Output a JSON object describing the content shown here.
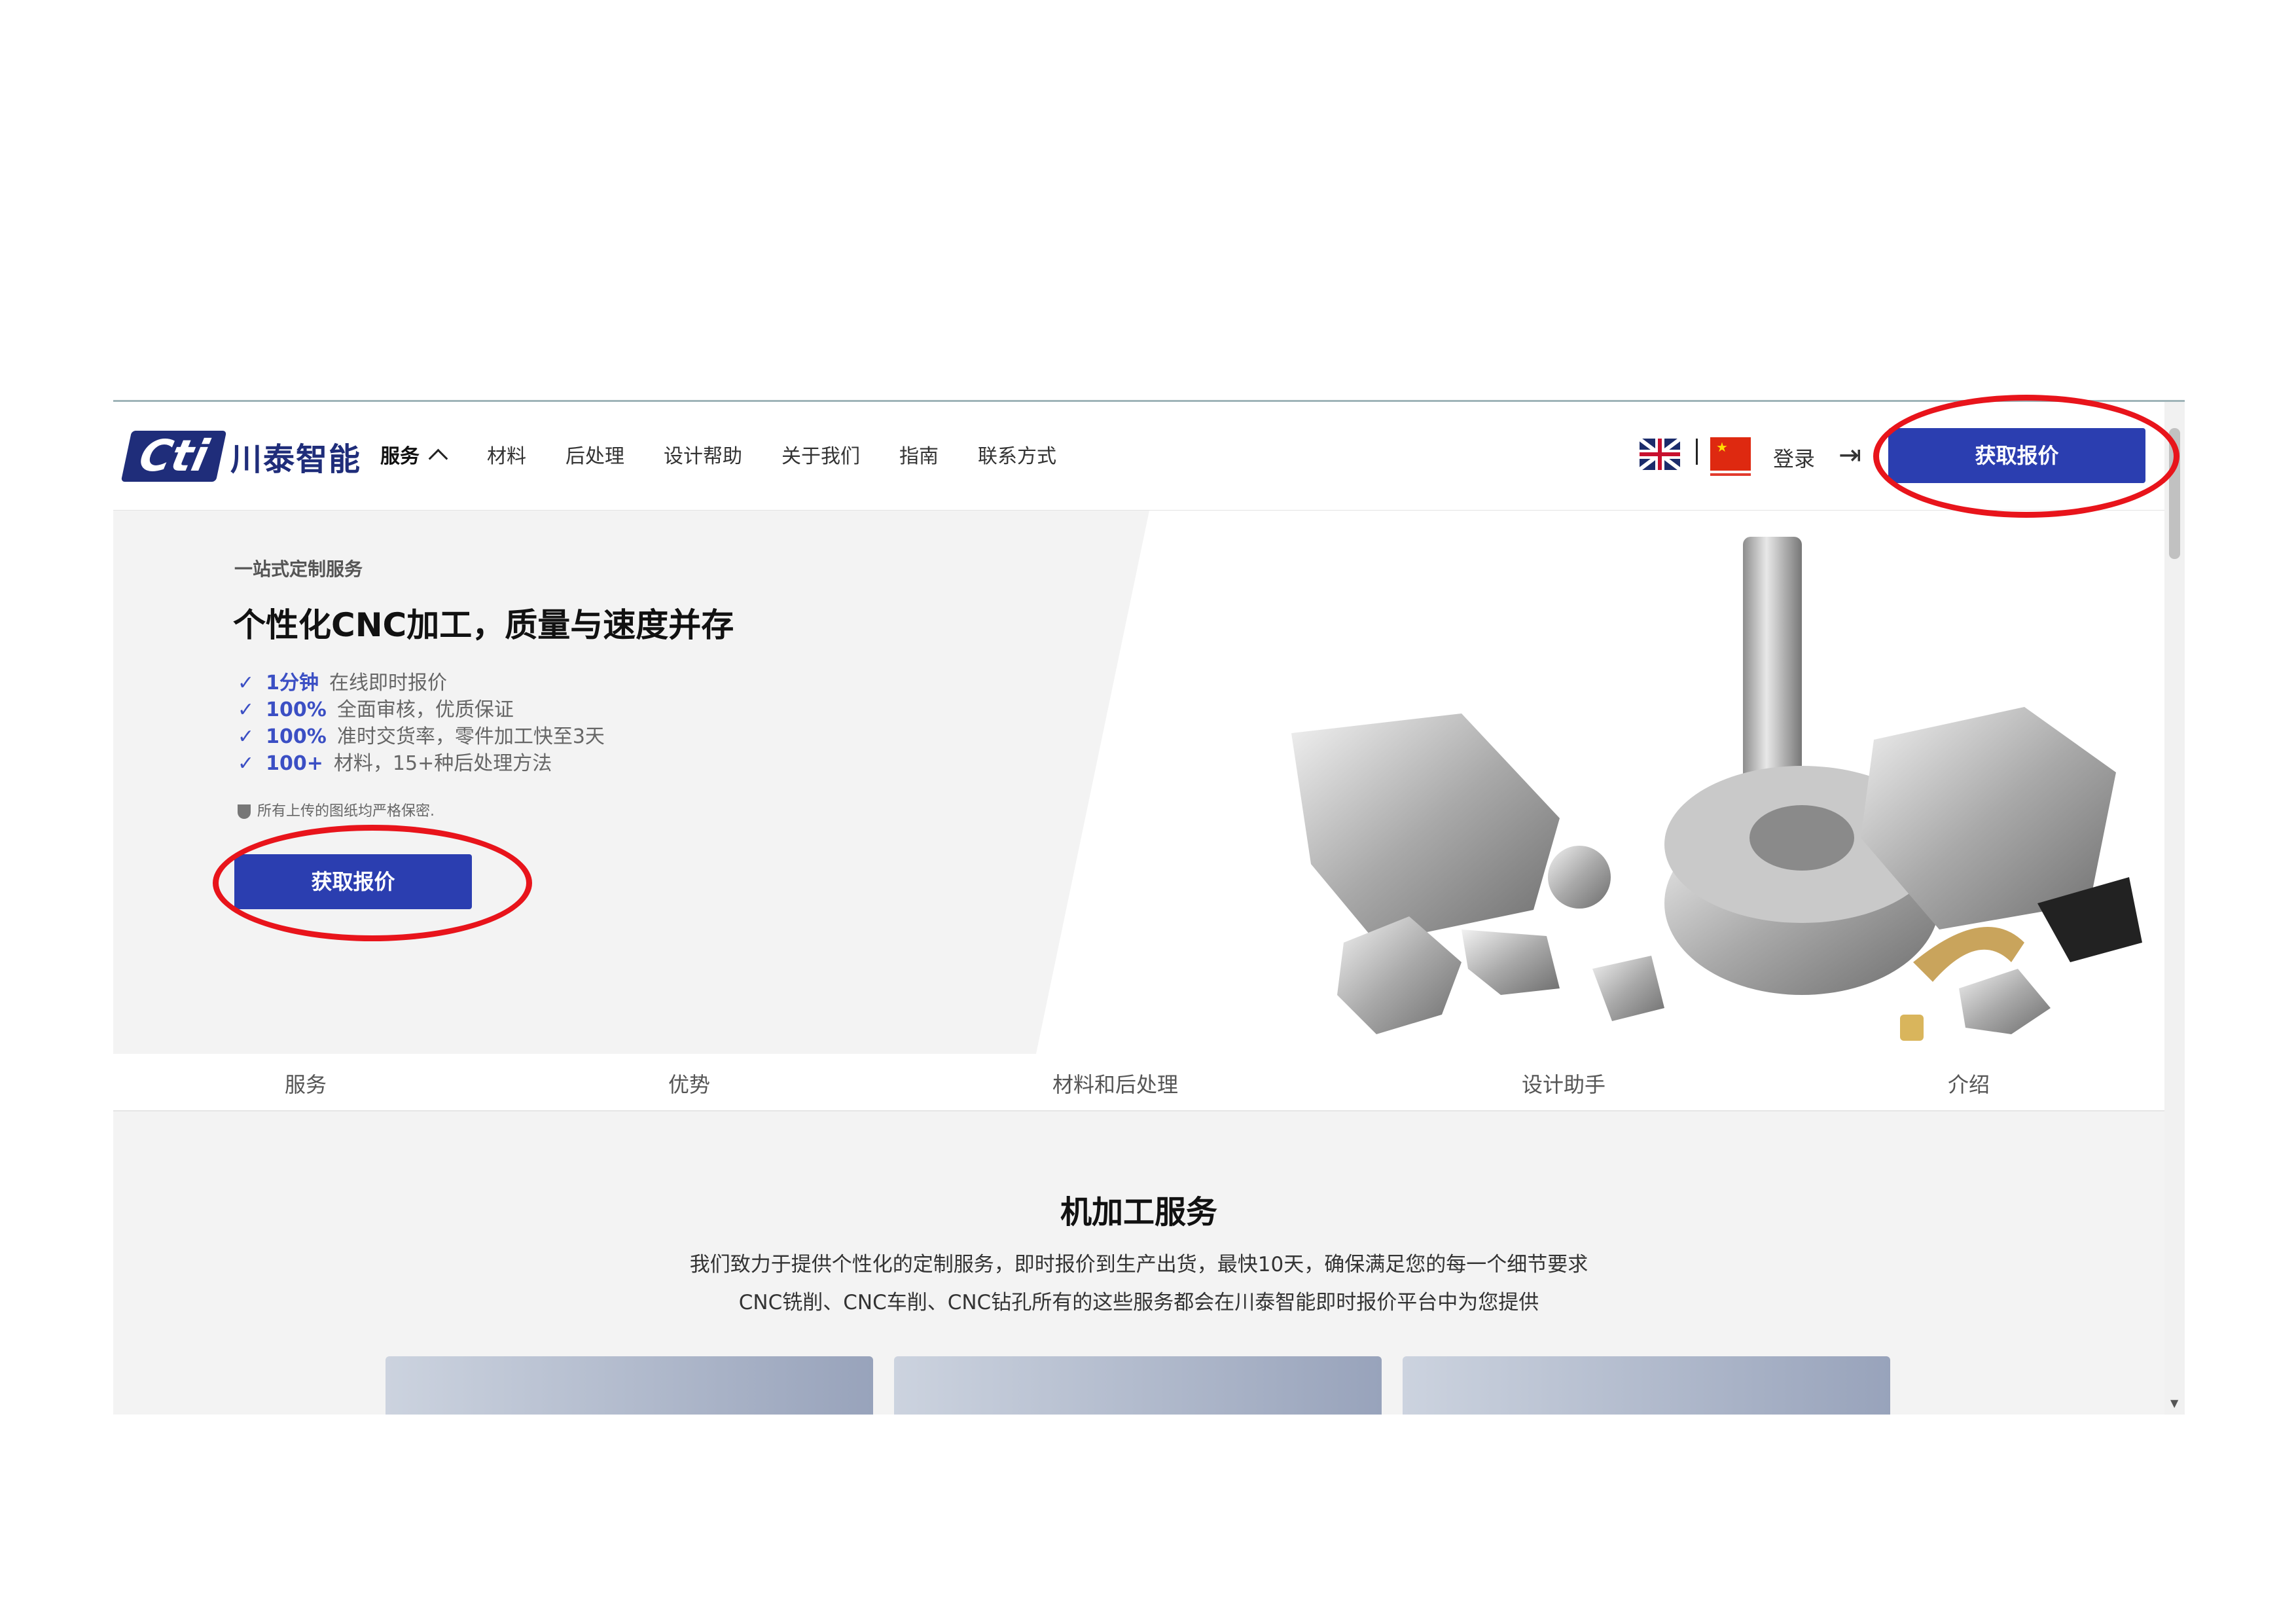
{
  "header": {
    "logo_mark": "Cti",
    "logo_text": "川泰智能",
    "nav": [
      "服务",
      "材料",
      "后处理",
      "设计帮助",
      "关于我们",
      "指南",
      "联系方式"
    ],
    "login": "登录",
    "quote_button": "获取报价"
  },
  "hero": {
    "label": "一站式定制服务",
    "title": "个性化CNC加工，质量与速度并存",
    "features": [
      {
        "num": "1分钟",
        "text": "在线即时报价"
      },
      {
        "num": "100%",
        "text": "全面审核，优质保证"
      },
      {
        "num": "100%",
        "text": "准时交货率，零件加工快至3天"
      },
      {
        "num": "100+",
        "text": "材料，15+种后处理方法"
      }
    ],
    "secure_note": "所有上传的图纸均严格保密.",
    "quote_button": "获取报价"
  },
  "tabs": [
    "服务",
    "优势",
    "材料和后处理",
    "设计助手",
    "介绍"
  ],
  "section": {
    "title": "机加工服务",
    "line1": "我们致力于提供个性化的定制服务，即时报价到生产出货，最快10天，确保满足您的每一个细节要求",
    "line2": "CNC铣削、CNC车削、CNC钻孔所有的这些服务都会在川泰智能即时报价平台中为您提供"
  },
  "colors": {
    "primary": "#2b3eb0",
    "annotation": "#e8141b",
    "logo": "#1f2d7a"
  }
}
